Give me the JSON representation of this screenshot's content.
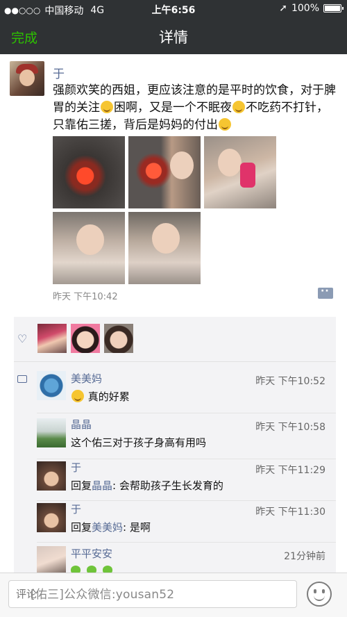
{
  "status_bar": {
    "signal_dots": "●●○○○",
    "carrier": "中国移动",
    "network": "4G",
    "time": "上午6:56",
    "location_arrow": "➚",
    "battery": "100%"
  },
  "nav": {
    "done_label": "完成",
    "title": "详情"
  },
  "post": {
    "author": "于",
    "text_1": "强颜欢笑的西姐，更应该注意的是平时的饮食，对于脾胃的关注",
    "text_2": "困啊，又是一个不眠夜",
    "text_3": "不吃药不打针，只靠佑三搓，背后是妈妈的付出",
    "time": "昨天 下午10:42"
  },
  "comments": [
    {
      "name": "美美妈",
      "time": "昨天 下午10:52",
      "text": "真的好累"
    },
    {
      "name": "晶晶",
      "time": "昨天 下午10:58",
      "text": "这个佑三对于孩子身高有用吗"
    },
    {
      "name": "于",
      "time": "昨天 下午11:29",
      "reply_prefix": "回复",
      "reply_to": "晶晶",
      "text": ": 会帮助孩子生长发育的"
    },
    {
      "name": "于",
      "time": "昨天 下午11:30",
      "reply_prefix": "回复",
      "reply_to": "美美妈",
      "text": ": 是啊"
    },
    {
      "name": "平平安安",
      "time": "21分钟前"
    }
  ],
  "input": {
    "placeholder": "评论",
    "watermark": "[佑三]公众微信:yousan52"
  },
  "colors": {
    "bar_bg": "#2f3234",
    "accent_green": "#2dc100",
    "link_blue": "#576b95"
  }
}
